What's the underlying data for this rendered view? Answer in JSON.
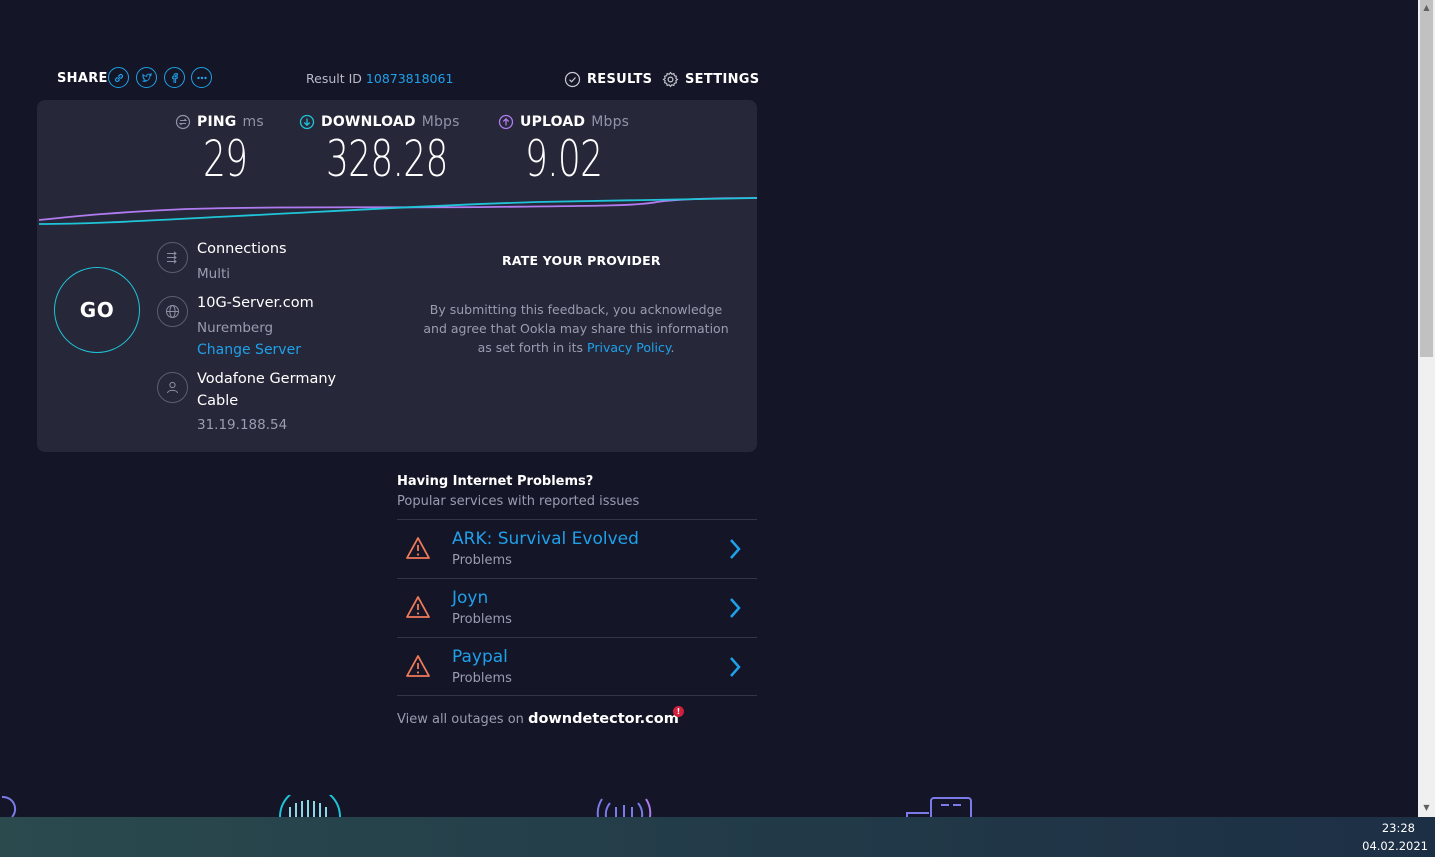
{
  "header": {
    "share_label": "SHARE",
    "share_icons": [
      "link-icon",
      "twitter-icon",
      "facebook-icon",
      "more-icon"
    ],
    "result_label": "Result ID",
    "result_id": "10873818061",
    "results_label": "RESULTS",
    "settings_label": "SETTINGS"
  },
  "metrics": {
    "ping": {
      "label": "PING",
      "unit": "ms",
      "value": "29"
    },
    "download": {
      "label": "DOWNLOAD",
      "unit": "Mbps",
      "value": "328.28"
    },
    "upload": {
      "label": "UPLOAD",
      "unit": "Mbps",
      "value": "9.02"
    }
  },
  "go_label": "GO",
  "connections": {
    "title": "Connections",
    "value": "Multi"
  },
  "server": {
    "name": "10G-Server.com",
    "location": "Nuremberg",
    "change_label": "Change Server"
  },
  "provider": {
    "name_line1": "Vodafone Germany",
    "name_line2": "Cable",
    "ip": "31.19.188.54"
  },
  "rate": {
    "title": "RATE YOUR PROVIDER",
    "body_line1": "By submitting this feedback, you acknowledge",
    "body_line2": "and agree that Ookla may share this information",
    "body_line3_prefix": "as set forth in its",
    "privacy_link": "Privacy Policy",
    "body_line3_suffix": "."
  },
  "problems": {
    "title": "Having Internet Problems?",
    "subtitle": "Popular services with reported issues",
    "items": [
      {
        "name": "ARK: Survival Evolved",
        "status": "Problems"
      },
      {
        "name": "Joyn",
        "status": "Problems"
      },
      {
        "name": "Paypal",
        "status": "Problems"
      }
    ],
    "outages_prefix": "View all outages on",
    "outages_site": "downdetector.com",
    "badge": "!"
  },
  "taskbar": {
    "time": "23:28",
    "date": "04.02.2021"
  },
  "colors": {
    "accent": "#1fa0ea",
    "download": "#20c4d8",
    "upload": "#b17bf0",
    "warning": "#f07a5a",
    "background": "#141526",
    "panel": "#262839"
  }
}
